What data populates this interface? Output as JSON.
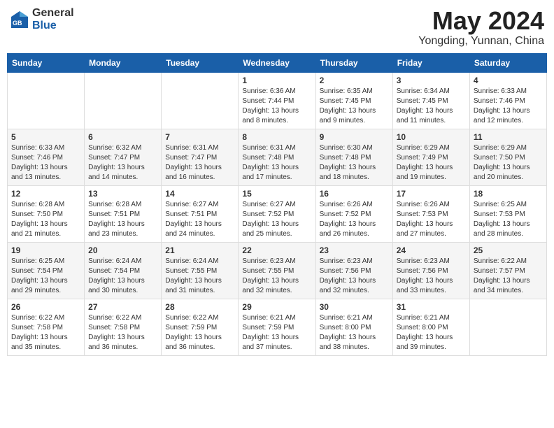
{
  "header": {
    "logo_general": "General",
    "logo_blue": "Blue",
    "month_title": "May 2024",
    "location": "Yongding, Yunnan, China"
  },
  "weekdays": [
    "Sunday",
    "Monday",
    "Tuesday",
    "Wednesday",
    "Thursday",
    "Friday",
    "Saturday"
  ],
  "weeks": [
    [
      {
        "day": "",
        "info": ""
      },
      {
        "day": "",
        "info": ""
      },
      {
        "day": "",
        "info": ""
      },
      {
        "day": "1",
        "info": "Sunrise: 6:36 AM\nSunset: 7:44 PM\nDaylight: 13 hours\nand 8 minutes."
      },
      {
        "day": "2",
        "info": "Sunrise: 6:35 AM\nSunset: 7:45 PM\nDaylight: 13 hours\nand 9 minutes."
      },
      {
        "day": "3",
        "info": "Sunrise: 6:34 AM\nSunset: 7:45 PM\nDaylight: 13 hours\nand 11 minutes."
      },
      {
        "day": "4",
        "info": "Sunrise: 6:33 AM\nSunset: 7:46 PM\nDaylight: 13 hours\nand 12 minutes."
      }
    ],
    [
      {
        "day": "5",
        "info": "Sunrise: 6:33 AM\nSunset: 7:46 PM\nDaylight: 13 hours\nand 13 minutes."
      },
      {
        "day": "6",
        "info": "Sunrise: 6:32 AM\nSunset: 7:47 PM\nDaylight: 13 hours\nand 14 minutes."
      },
      {
        "day": "7",
        "info": "Sunrise: 6:31 AM\nSunset: 7:47 PM\nDaylight: 13 hours\nand 16 minutes."
      },
      {
        "day": "8",
        "info": "Sunrise: 6:31 AM\nSunset: 7:48 PM\nDaylight: 13 hours\nand 17 minutes."
      },
      {
        "day": "9",
        "info": "Sunrise: 6:30 AM\nSunset: 7:48 PM\nDaylight: 13 hours\nand 18 minutes."
      },
      {
        "day": "10",
        "info": "Sunrise: 6:29 AM\nSunset: 7:49 PM\nDaylight: 13 hours\nand 19 minutes."
      },
      {
        "day": "11",
        "info": "Sunrise: 6:29 AM\nSunset: 7:50 PM\nDaylight: 13 hours\nand 20 minutes."
      }
    ],
    [
      {
        "day": "12",
        "info": "Sunrise: 6:28 AM\nSunset: 7:50 PM\nDaylight: 13 hours\nand 21 minutes."
      },
      {
        "day": "13",
        "info": "Sunrise: 6:28 AM\nSunset: 7:51 PM\nDaylight: 13 hours\nand 23 minutes."
      },
      {
        "day": "14",
        "info": "Sunrise: 6:27 AM\nSunset: 7:51 PM\nDaylight: 13 hours\nand 24 minutes."
      },
      {
        "day": "15",
        "info": "Sunrise: 6:27 AM\nSunset: 7:52 PM\nDaylight: 13 hours\nand 25 minutes."
      },
      {
        "day": "16",
        "info": "Sunrise: 6:26 AM\nSunset: 7:52 PM\nDaylight: 13 hours\nand 26 minutes."
      },
      {
        "day": "17",
        "info": "Sunrise: 6:26 AM\nSunset: 7:53 PM\nDaylight: 13 hours\nand 27 minutes."
      },
      {
        "day": "18",
        "info": "Sunrise: 6:25 AM\nSunset: 7:53 PM\nDaylight: 13 hours\nand 28 minutes."
      }
    ],
    [
      {
        "day": "19",
        "info": "Sunrise: 6:25 AM\nSunset: 7:54 PM\nDaylight: 13 hours\nand 29 minutes."
      },
      {
        "day": "20",
        "info": "Sunrise: 6:24 AM\nSunset: 7:54 PM\nDaylight: 13 hours\nand 30 minutes."
      },
      {
        "day": "21",
        "info": "Sunrise: 6:24 AM\nSunset: 7:55 PM\nDaylight: 13 hours\nand 31 minutes."
      },
      {
        "day": "22",
        "info": "Sunrise: 6:23 AM\nSunset: 7:55 PM\nDaylight: 13 hours\nand 32 minutes."
      },
      {
        "day": "23",
        "info": "Sunrise: 6:23 AM\nSunset: 7:56 PM\nDaylight: 13 hours\nand 32 minutes."
      },
      {
        "day": "24",
        "info": "Sunrise: 6:23 AM\nSunset: 7:56 PM\nDaylight: 13 hours\nand 33 minutes."
      },
      {
        "day": "25",
        "info": "Sunrise: 6:22 AM\nSunset: 7:57 PM\nDaylight: 13 hours\nand 34 minutes."
      }
    ],
    [
      {
        "day": "26",
        "info": "Sunrise: 6:22 AM\nSunset: 7:58 PM\nDaylight: 13 hours\nand 35 minutes."
      },
      {
        "day": "27",
        "info": "Sunrise: 6:22 AM\nSunset: 7:58 PM\nDaylight: 13 hours\nand 36 minutes."
      },
      {
        "day": "28",
        "info": "Sunrise: 6:22 AM\nSunset: 7:59 PM\nDaylight: 13 hours\nand 36 minutes."
      },
      {
        "day": "29",
        "info": "Sunrise: 6:21 AM\nSunset: 7:59 PM\nDaylight: 13 hours\nand 37 minutes."
      },
      {
        "day": "30",
        "info": "Sunrise: 6:21 AM\nSunset: 8:00 PM\nDaylight: 13 hours\nand 38 minutes."
      },
      {
        "day": "31",
        "info": "Sunrise: 6:21 AM\nSunset: 8:00 PM\nDaylight: 13 hours\nand 39 minutes."
      },
      {
        "day": "",
        "info": ""
      }
    ]
  ]
}
